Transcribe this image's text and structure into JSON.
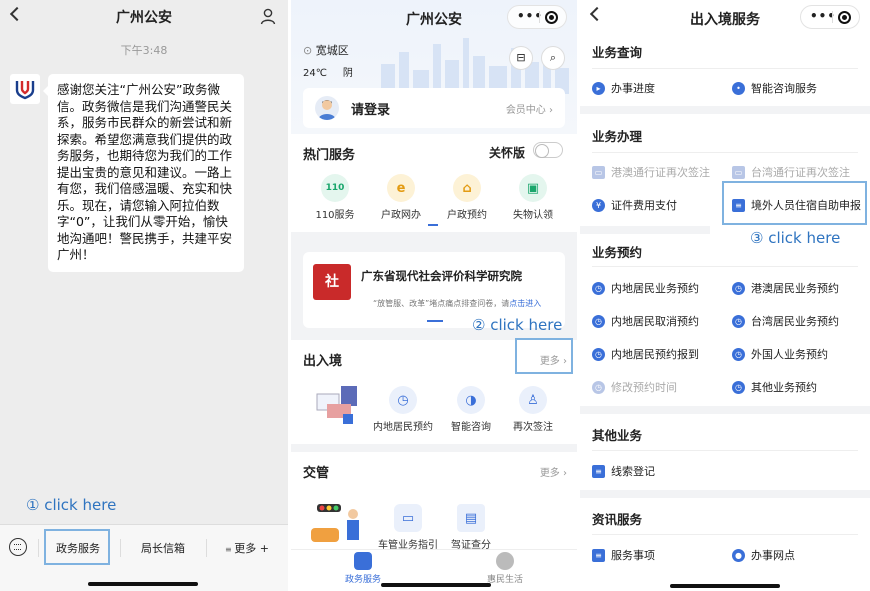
{
  "screen1": {
    "title": "广州公安",
    "time": "下午3:48",
    "message": "感谢您关注“广州公安”政务微信。政务微信是我们沟通警民关系，服务市民群众的新尝试和新探索。希望您满意我们提供的政务服务，也期待您为我们的工作提出宝贵的意见和建议。一路上有您，我们倍感温暖、充实和快乐。现在，请您输入阿拉伯数字“0”，让我们从零开始，愉快地沟通吧！警民携手，共建平安广州！",
    "menu": [
      "政务服务",
      "局长信箱",
      "更多 +"
    ],
    "annotation": "① click here"
  },
  "screen2": {
    "title": "广州公安",
    "location": "宽城区",
    "temperature": "24℃",
    "weather": "阴",
    "login_label": "请登录",
    "member_center": "会员中心",
    "hot_title": "热门服务",
    "care_label": "关怀版",
    "hot_services": [
      "110服务",
      "户政网办",
      "户政预约",
      "失物认领"
    ],
    "banner_title": "广东省现代社会评价科学研究院",
    "banner_sub": "“放管服、改革”堵点痛点排查问卷，请",
    "banner_link": "点击进入",
    "annotation": "② click here",
    "border_title": "出入境",
    "more_label": "更多",
    "border_services": [
      "内地居民预约",
      "智能咨询",
      "再次签注"
    ],
    "traffic_title": "交管",
    "traffic_more": "更多",
    "traffic_services": [
      "车管业务指引",
      "驾证查分"
    ],
    "tabs": [
      "政务服务",
      "惠民生活"
    ]
  },
  "screen3": {
    "title": "出入境服务",
    "groups": [
      {
        "title": "业务查询",
        "items": [
          {
            "label": "办事进度",
            "disabled": false
          },
          {
            "label": "智能咨询服务",
            "disabled": false
          }
        ]
      },
      {
        "title": "业务办理",
        "items": [
          {
            "label": "港澳通行证再次签注",
            "disabled": true
          },
          {
            "label": "台湾通行证再次签注",
            "disabled": true
          },
          {
            "label": "证件费用支付",
            "disabled": false
          },
          {
            "label": "境外人员住宿自助申报",
            "disabled": false
          }
        ]
      },
      {
        "title": "业务预约",
        "items": [
          {
            "label": "内地居民业务预约",
            "disabled": false
          },
          {
            "label": "港澳居民业务预约",
            "disabled": false
          },
          {
            "label": "内地居民取消预约",
            "disabled": false
          },
          {
            "label": "台湾居民业务预约",
            "disabled": false
          },
          {
            "label": "内地居民预约报到",
            "disabled": false
          },
          {
            "label": "外国人业务预约",
            "disabled": false
          },
          {
            "label": "修改预约时间",
            "disabled": true
          },
          {
            "label": "其他业务预约",
            "disabled": false
          }
        ]
      },
      {
        "title": "其他业务",
        "items": [
          {
            "label": "线索登记",
            "disabled": false
          }
        ]
      },
      {
        "title": "资讯服务",
        "items": [
          {
            "label": "服务事项",
            "disabled": false
          },
          {
            "label": "办事网点",
            "disabled": false
          }
        ]
      }
    ],
    "annotation": "③ click here"
  },
  "colors": {
    "accent": "#2f74c0",
    "highlight": "#7fb2e0",
    "primary_blue": "#3a6fd8"
  }
}
